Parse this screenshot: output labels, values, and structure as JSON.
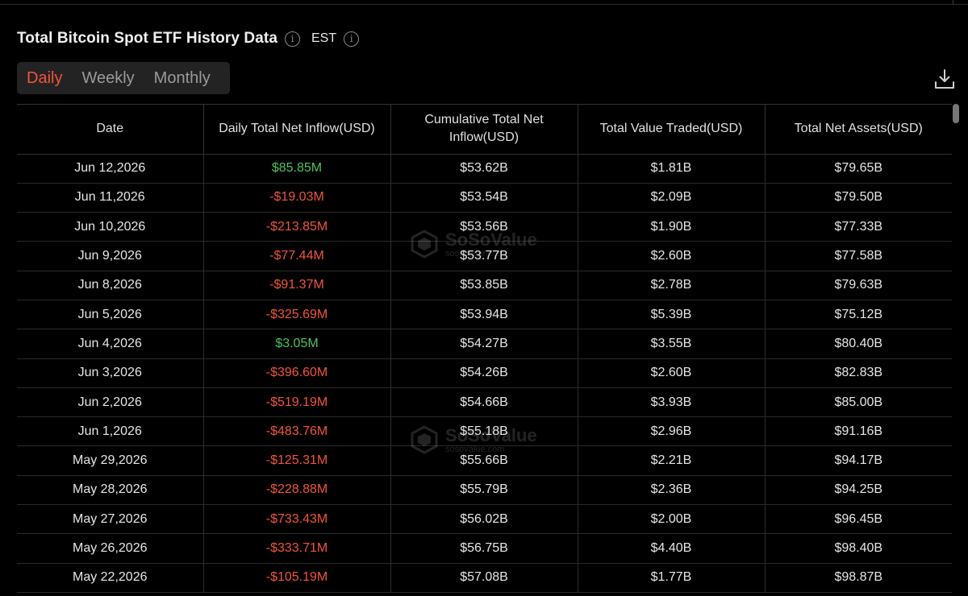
{
  "header": {
    "title": "Total Bitcoin Spot ETF History Data",
    "timezone": "EST"
  },
  "tabs": [
    {
      "label": "Daily",
      "active": true
    },
    {
      "label": "Weekly",
      "active": false
    },
    {
      "label": "Monthly",
      "active": false
    }
  ],
  "watermark": {
    "brand": "SoSoValue",
    "domain": "sosovalue.com"
  },
  "table": {
    "columns": [
      "Date",
      "Daily Total Net Inflow(USD)",
      "Cumulative Total Net Inflow(USD)",
      "Total Value Traded(USD)",
      "Total Net Assets(USD)"
    ],
    "rows": [
      {
        "date": "Jun 12,2026",
        "inflow": "$85.85M",
        "cumulative": "$53.62B",
        "traded": "$1.81B",
        "assets": "$79.65B"
      },
      {
        "date": "Jun 11,2026",
        "inflow": "-$19.03M",
        "cumulative": "$53.54B",
        "traded": "$2.09B",
        "assets": "$79.50B"
      },
      {
        "date": "Jun 10,2026",
        "inflow": "-$213.85M",
        "cumulative": "$53.56B",
        "traded": "$1.90B",
        "assets": "$77.33B"
      },
      {
        "date": "Jun 9,2026",
        "inflow": "-$77.44M",
        "cumulative": "$53.77B",
        "traded": "$2.60B",
        "assets": "$77.58B"
      },
      {
        "date": "Jun 8,2026",
        "inflow": "-$91.37M",
        "cumulative": "$53.85B",
        "traded": "$2.78B",
        "assets": "$79.63B"
      },
      {
        "date": "Jun 5,2026",
        "inflow": "-$325.69M",
        "cumulative": "$53.94B",
        "traded": "$5.39B",
        "assets": "$75.12B"
      },
      {
        "date": "Jun 4,2026",
        "inflow": "$3.05M",
        "cumulative": "$54.27B",
        "traded": "$3.55B",
        "assets": "$80.40B"
      },
      {
        "date": "Jun 3,2026",
        "inflow": "-$396.60M",
        "cumulative": "$54.26B",
        "traded": "$2.60B",
        "assets": "$82.83B"
      },
      {
        "date": "Jun 2,2026",
        "inflow": "-$519.19M",
        "cumulative": "$54.66B",
        "traded": "$3.93B",
        "assets": "$85.00B"
      },
      {
        "date": "Jun 1,2026",
        "inflow": "-$483.76M",
        "cumulative": "$55.18B",
        "traded": "$2.96B",
        "assets": "$91.16B"
      },
      {
        "date": "May 29,2026",
        "inflow": "-$125.31M",
        "cumulative": "$55.66B",
        "traded": "$2.21B",
        "assets": "$94.17B"
      },
      {
        "date": "May 28,2026",
        "inflow": "-$228.88M",
        "cumulative": "$55.79B",
        "traded": "$2.36B",
        "assets": "$94.25B"
      },
      {
        "date": "May 27,2026",
        "inflow": "-$733.43M",
        "cumulative": "$56.02B",
        "traded": "$2.00B",
        "assets": "$96.45B"
      },
      {
        "date": "May 26,2026",
        "inflow": "-$333.71M",
        "cumulative": "$56.75B",
        "traded": "$4.40B",
        "assets": "$98.40B"
      },
      {
        "date": "May 22,2026",
        "inflow": "-$105.19M",
        "cumulative": "$57.08B",
        "traded": "$1.77B",
        "assets": "$98.87B"
      }
    ]
  },
  "colors": {
    "background": "#000000",
    "accent": "#f0553a",
    "positive": "#4cc35b",
    "negative": "#f0553a",
    "tab_bg": "#232323",
    "grid": "#333333"
  }
}
